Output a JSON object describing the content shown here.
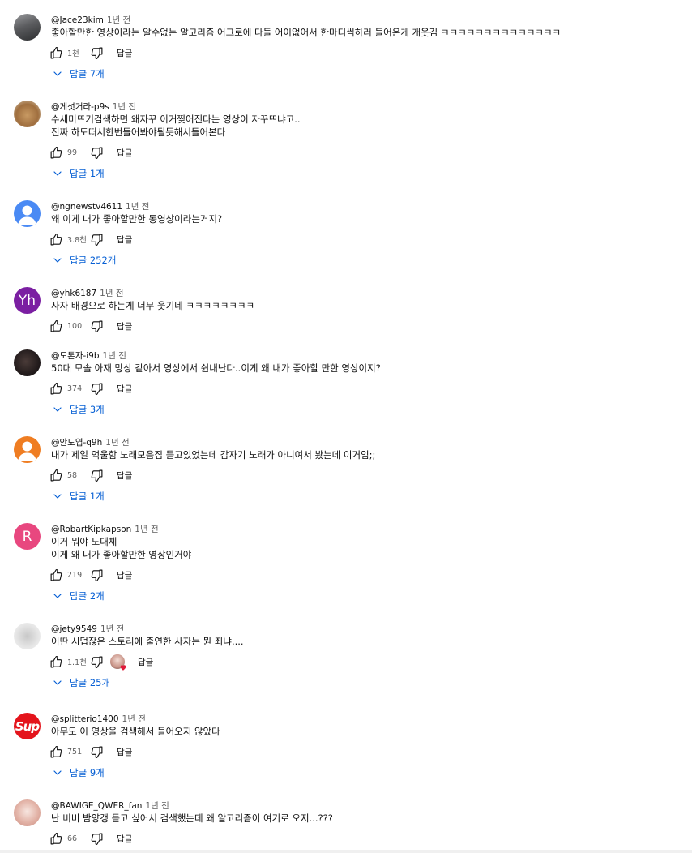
{
  "comments": [
    {
      "author": "@Jace23kim",
      "time": "1년 전",
      "lines": [
        "좋아할만한 영상이라는 알수없는 알고리즘 어그로에 다들 어이없어서 한마디씩하러 들어온게 개웃김 ㅋㅋㅋㅋㅋㅋㅋㅋㅋㅋㅋㅋㅋㅋ"
      ],
      "likes": "1천",
      "reply_label": "답글",
      "replies": "답글 7개",
      "avatar": {
        "type": "image",
        "name": "dark-avatar",
        "bg": "#6f7073"
      }
    },
    {
      "author": "@게섯거라-p9s",
      "time": "1년 전",
      "lines": [
        "수세미뜨기검색하면 왜자꾸 이거찢어진다는 영상이 자꾸뜨냐고..",
        "진짜 하도떠서한번들어봐야될듯해서들어본다"
      ],
      "likes": "99",
      "reply_label": "답글",
      "replies": "답글 1개",
      "avatar": {
        "type": "image",
        "name": "teddy-bear-avatar",
        "bg": "#b58a5a"
      }
    },
    {
      "author": "@ngnewstv4611",
      "time": "1년 전",
      "lines": [
        "왜 이게 내가 좋아할만한 동영상이라는거지?"
      ],
      "likes": "3.8천",
      "reply_label": "답글",
      "replies": "답글 252개",
      "avatar": {
        "type": "default",
        "name": "default-user-avatar",
        "bg": "#4a8af4"
      }
    },
    {
      "author": "@yhk6187",
      "time": "1년 전",
      "lines": [
        "사자 배경으로 하는게 너무 웃기네 ㅋㅋㅋㅋㅋㅋㅋㅋ"
      ],
      "likes": "100",
      "reply_label": "답글",
      "replies": "",
      "avatar": {
        "type": "letter",
        "letter": "Yh",
        "name": "letter-avatar",
        "bg": "#7b1fa2"
      }
    },
    {
      "author": "@도톤자-i9b",
      "time": "1년 전",
      "lines": [
        "50대 모솔 아재 망상 같아서 영상에서 쉰내난다..이게 왜 내가 좋아할 만한 영상이지?"
      ],
      "likes": "374",
      "reply_label": "답글",
      "replies": "답글 3개",
      "avatar": {
        "type": "image",
        "name": "photo-avatar",
        "bg": "#2a2424"
      }
    },
    {
      "author": "@안도엽-q9h",
      "time": "1년 전",
      "lines": [
        "내가 제일 억울함 노래모음집 듣고있었는데 갑자기 노래가 아니여서 봤는데 이거임;;"
      ],
      "likes": "58",
      "reply_label": "답글",
      "replies": "답글 1개",
      "avatar": {
        "type": "default",
        "name": "default-user-avatar",
        "bg": "#ef7d22"
      }
    },
    {
      "author": "@RobartKipkapson",
      "time": "1년 전",
      "lines": [
        "이거 뭐야 도대체",
        "이게 왜 내가 좋아할만한 영상인거야"
      ],
      "likes": "219",
      "reply_label": "답글",
      "replies": "답글 2개",
      "avatar": {
        "type": "letter",
        "letter": "R",
        "name": "letter-avatar",
        "bg": "#e8477f"
      }
    },
    {
      "author": "@jety9549",
      "time": "1년 전",
      "lines": [
        "이딴 시덥잖은 스토리에 출연한 사자는 뭔 죄냐...."
      ],
      "likes": "1.1천",
      "reply_label": "답글",
      "replies": "답글 25개",
      "avatar": {
        "type": "image",
        "name": "sketch-avatar",
        "bg": "#d6d6d6"
      },
      "heart": true
    },
    {
      "author": "@splitterio1400",
      "time": "1년 전",
      "lines": [
        "아무도 이 영상을 검색해서 들어오지 않았다"
      ],
      "likes": "751",
      "reply_label": "답글",
      "replies": "답글 9개",
      "avatar": {
        "type": "supreme",
        "letter": "Sup",
        "name": "supreme-logo-avatar",
        "bg": "#e4141c"
      }
    },
    {
      "author": "@BAWIGE_QWER_fan",
      "time": "1년 전",
      "lines": [
        "난 비비 밤양갱 듣고 싶어서 검색했는데 왜 알고리즘이 여기로 오지...???"
      ],
      "likes": "66",
      "reply_label": "답글",
      "replies": "",
      "avatar": {
        "type": "image",
        "name": "girl-photo-avatar",
        "bg": "#f2d6d2"
      }
    }
  ],
  "colors": {
    "link": "#065fd4",
    "secondary": "#606060",
    "heart": "#e01b3a"
  }
}
